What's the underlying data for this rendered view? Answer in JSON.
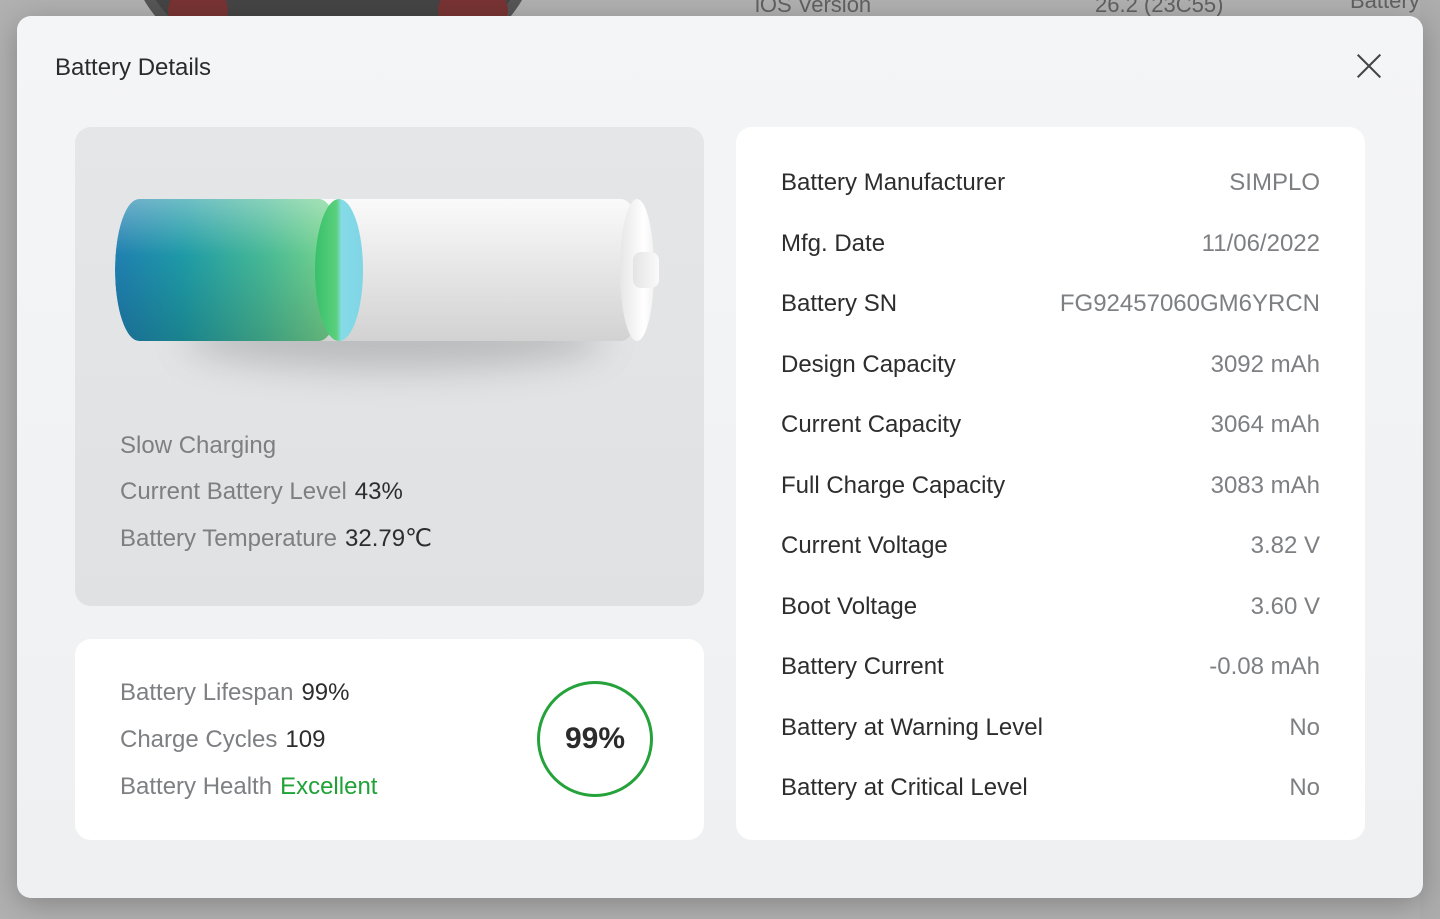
{
  "background": {
    "ios_version_label": "iOS Version",
    "ios_version_value": "26.2 (23C55)",
    "battery_label": "Battery I"
  },
  "dialog": {
    "title": "Battery Details",
    "close_icon": "close-icon"
  },
  "status": {
    "charging_state": "Slow Charging",
    "level_label": "Current Battery Level",
    "level_value": "43%",
    "level_fraction": 0.43,
    "temperature_label": "Battery Temperature",
    "temperature_value": "32.79℃",
    "fill_colors": [
      "#1f7fb0",
      "#1e9aa6",
      "#46b895",
      "#7ed88a"
    ]
  },
  "health": {
    "lifespan_label": "Battery Lifespan",
    "lifespan_value": "99%",
    "cycles_label": "Charge Cycles",
    "cycles_value": "109",
    "health_label": "Battery Health",
    "health_value": "Excellent",
    "ring_value": "99%",
    "accent_color": "#25a23a"
  },
  "details": [
    {
      "label": "Battery Manufacturer",
      "value": "SIMPLO"
    },
    {
      "label": "Mfg. Date",
      "value": "11/06/2022"
    },
    {
      "label": "Battery SN",
      "value": "FG92457060GM6YRCN"
    },
    {
      "label": "Design Capacity",
      "value": "3092 mAh"
    },
    {
      "label": "Current Capacity",
      "value": "3064 mAh"
    },
    {
      "label": "Full Charge Capacity",
      "value": "3083 mAh"
    },
    {
      "label": "Current Voltage",
      "value": "3.82 V"
    },
    {
      "label": "Boot Voltage",
      "value": "3.60 V"
    },
    {
      "label": "Battery Current",
      "value": "-0.08 mAh"
    },
    {
      "label": "Battery at Warning Level",
      "value": "No"
    },
    {
      "label": "Battery at Critical Level",
      "value": "No"
    }
  ]
}
